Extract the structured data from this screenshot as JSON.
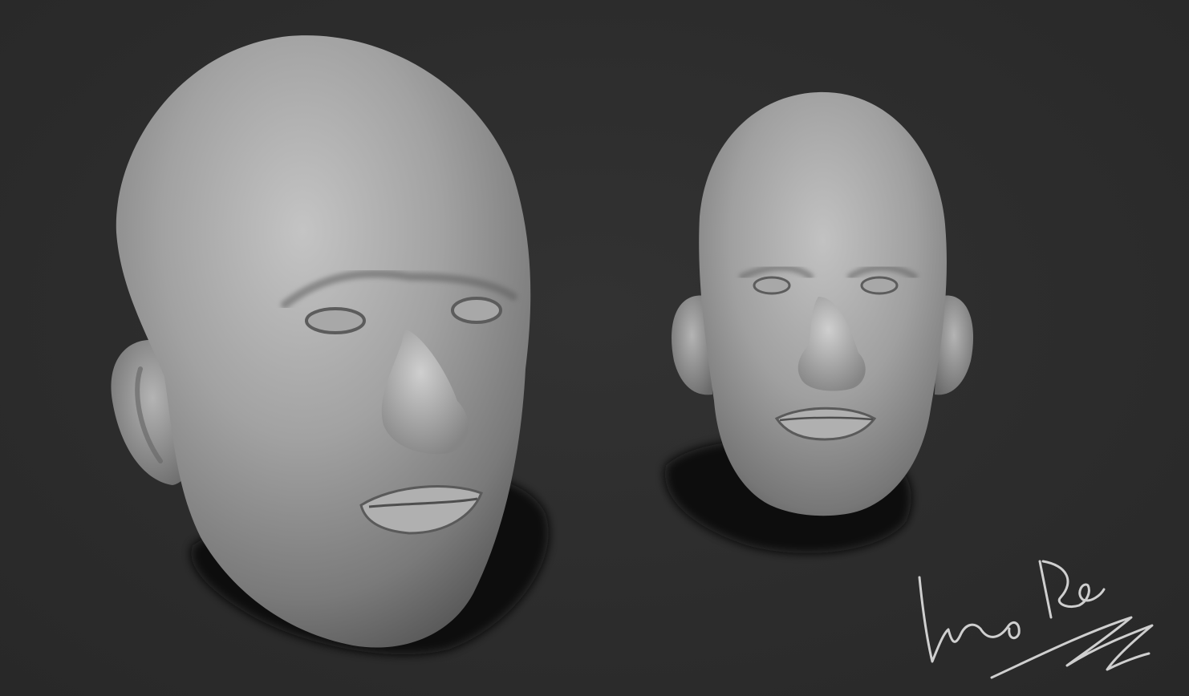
{
  "scene": {
    "description_free": true,
    "background_color": "#2d2d2d",
    "clay_color": "#9a9a9a",
    "shadow_color": "#0a0a0a",
    "signature_color": "#cfcfcf"
  },
  "signature": {
    "text": "Luka Ra"
  }
}
